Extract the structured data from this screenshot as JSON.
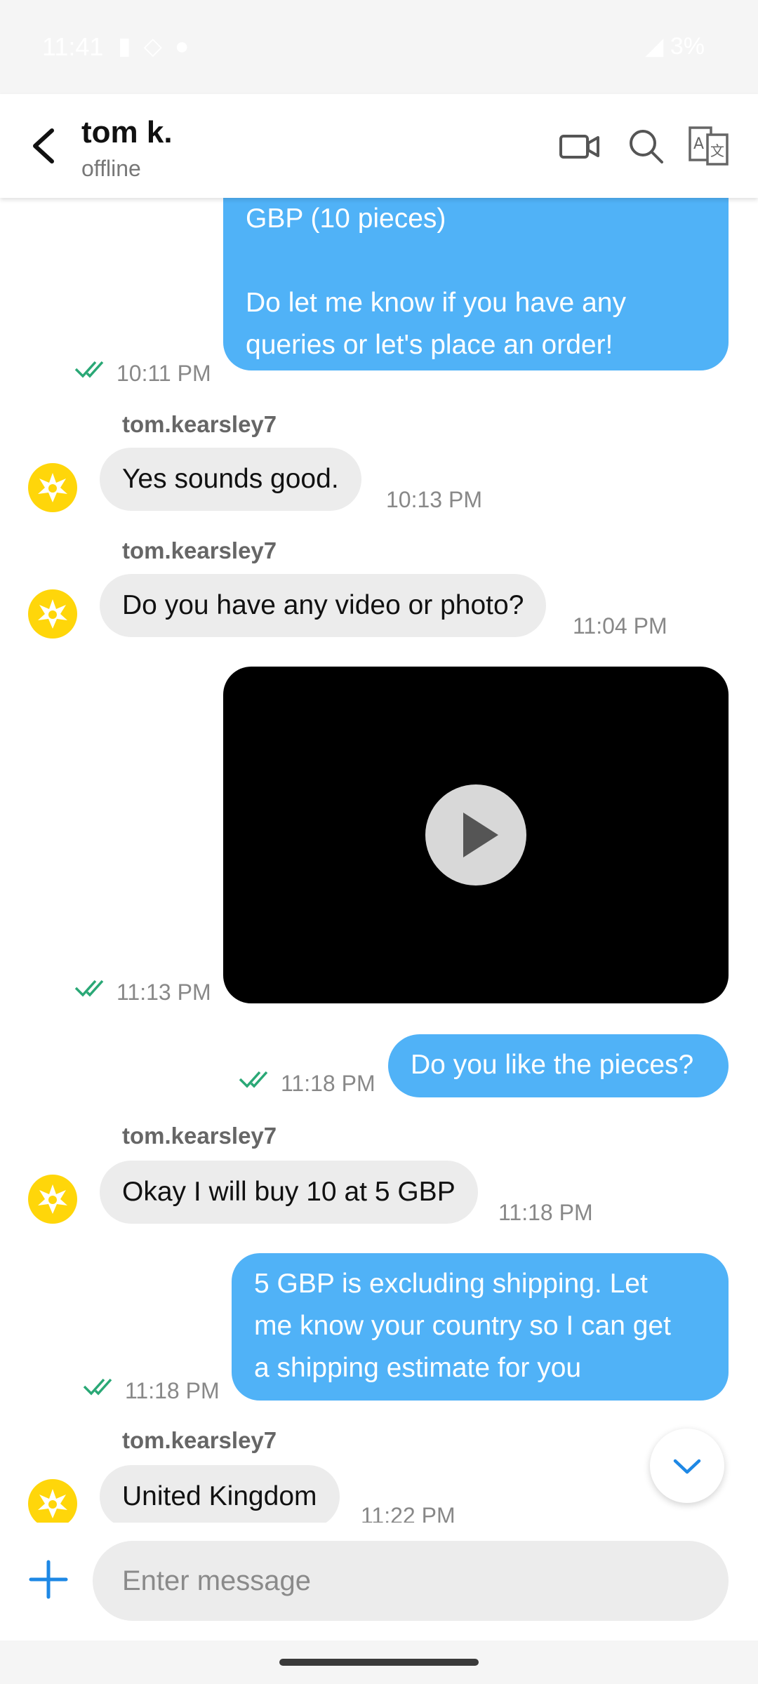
{
  "status_bar": {
    "time": "11:41",
    "battery": "3%"
  },
  "header": {
    "name": "tom k.",
    "status": "offline"
  },
  "messages": {
    "m1": {
      "text_line1": "GBP (10 pieces)",
      "text_line2": "Do let me know if you have any",
      "text_line3": "queries  or let's place an order!",
      "time": "10:11 PM"
    },
    "m2": {
      "sender": "tom.kearsley7",
      "text": "Yes sounds good.",
      "time": "10:13 PM"
    },
    "m3": {
      "sender": "tom.kearsley7",
      "text": "Do you have any video or photo?",
      "time": "11:04 PM"
    },
    "m4": {
      "time": "11:13 PM"
    },
    "m5": {
      "text": "Do you like the pieces?",
      "time": "11:18 PM"
    },
    "m6": {
      "sender": "tom.kearsley7",
      "text": "Okay I will buy 10 at 5 GBP",
      "time": "11:18 PM"
    },
    "m7": {
      "text_line1": "5 GBP is excluding shipping. Let",
      "text_line2": "me know your country so I can get",
      "text_line3": "a shipping estimate for you",
      "time": "11:18 PM"
    },
    "m8": {
      "sender": "tom.kearsley7",
      "text": "United Kingdom",
      "time": "11:22 PM"
    }
  },
  "composer": {
    "placeholder": "Enter message"
  },
  "colors": {
    "outgoing_bubble": "#50b2f7",
    "incoming_bubble": "#ececec",
    "read_check": "#2aa876",
    "avatar": "#ffd60a",
    "accent": "#1e88e5"
  }
}
